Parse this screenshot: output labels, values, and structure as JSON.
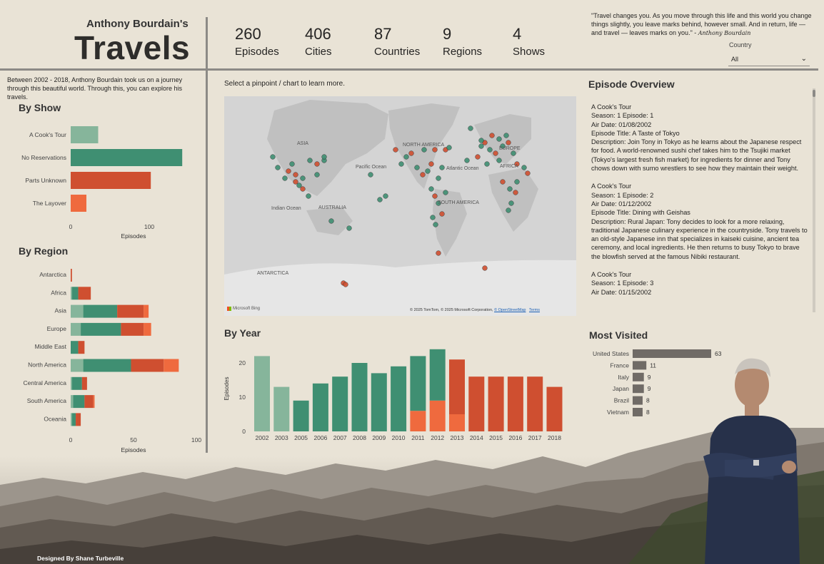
{
  "header": {
    "pre_title": "Anthony Bourdain's",
    "title": "Travels",
    "kpis": [
      {
        "value": "260",
        "label": "Episodes"
      },
      {
        "value": "406",
        "label": "Cities"
      },
      {
        "value": "87",
        "label": "Countries"
      },
      {
        "value": "9",
        "label": "Regions"
      },
      {
        "value": "4",
        "label": "Shows"
      }
    ],
    "quote": "\"Travel changes you. As you move through this life and this world you change things slightly, you leave marks behind, however small. And in return, life — and travel — leaves marks on you.\" -",
    "signature": "Anthony Bourdain",
    "country_filter": {
      "label": "Country",
      "value": "All"
    }
  },
  "intro": "Between 2002 - 2018, Anthony Bourdain took us on a journey through this beautiful world. Through this, you can explore his travels.",
  "map": {
    "instruction": "Select a pinpoint / chart to learn more.",
    "labels": [
      "ASIA",
      "NORTH AMERICA",
      "EUROPE",
      "Pacific Ocean",
      "Atlantic Ocean",
      "AFRICA",
      "Indian Ocean",
      "AUSTRALIA",
      "SOUTH AMERICA",
      "ANTARCTICA"
    ],
    "bing_label": "Microsoft Bing",
    "attribution": "© 2025 TomTom, © 2025 Microsoft Corporation,",
    "osm_link": "© OpenStreetMap",
    "terms_link": "Terms"
  },
  "colors": {
    "cooks_tour": "#86b59b",
    "no_reservations": "#3f8f72",
    "parts_unknown": "#cf4f30",
    "the_layover": "#ef6a3e",
    "gray_bar": "#706b66",
    "background": "#e9e3d6"
  },
  "by_show": {
    "title": "By Show",
    "xlabel": "Episodes",
    "ticks": [
      "0",
      "100"
    ]
  },
  "by_region": {
    "title": "By Region",
    "xlabel": "Episodes",
    "ticks": [
      "0",
      "50",
      "100"
    ]
  },
  "by_year": {
    "title": "By Year",
    "ylabel": "Episodes",
    "ticks": [
      "0",
      "10",
      "20"
    ]
  },
  "episode_overview": {
    "title": "Episode Overview",
    "episodes": [
      {
        "show": "A Cook's Tour",
        "season_episode": "Season: 1 Episode: 1",
        "air_date": "Air Date: 01/08/2002",
        "episode_title": "Episode Title: A Taste of Tokyo",
        "description": "Description: Join Tony in Tokyo as he learns about the Japanese respect for food. A world-renowned sushi chef takes him to the Tsujiki market (Tokyo's largest fresh fish market) for ingredients for dinner and Tony chows down with sumo wrestlers to see how they maintain their weight."
      },
      {
        "show": "A Cook's Tour",
        "season_episode": "Season: 1 Episode: 2",
        "air_date": "Air Date: 01/12/2002",
        "episode_title": "Episode Title: Dining with Geishas",
        "description": "Description: Rural Japan: Tony decides to look for a more relaxing, traditional Japanese culinary experience in the countryside. Tony travels to an old-style Japanese inn that specializes in kaiseki cuisine, ancient tea ceremony, and local ingredients. He then returns to busy Tokyo to brave the blowfish served at the famous Nibiki restaurant."
      },
      {
        "show": "A Cook's Tour",
        "season_episode": "Season: 1 Episode: 3",
        "air_date": "Air Date: 01/15/2002",
        "episode_title": "",
        "description": ""
      }
    ]
  },
  "most_visited": {
    "title": "Most Visited"
  },
  "credit": "Designed By Shane Turbeville",
  "chart_data": [
    {
      "type": "bar",
      "orientation": "horizontal",
      "title": "By Show",
      "xlabel": "Episodes",
      "categories": [
        "A Cook's Tour",
        "No Reservations",
        "Parts Unknown",
        "The Layover"
      ],
      "values": [
        35,
        142,
        102,
        20
      ],
      "xlim": [
        0,
        150
      ]
    },
    {
      "type": "bar",
      "orientation": "horizontal",
      "stacked": true,
      "title": "By Region",
      "xlabel": "Episodes",
      "xlim": [
        0,
        100
      ],
      "categories": [
        "Antarctica",
        "Africa",
        "Asia",
        "Europe",
        "Middle East",
        "North America",
        "Central America",
        "South America",
        "Oceania"
      ],
      "series": [
        {
          "name": "A Cook's Tour",
          "values": [
            0,
            1,
            10,
            8,
            0,
            10,
            1,
            2,
            1
          ]
        },
        {
          "name": "No Reservations",
          "values": [
            0,
            5,
            27,
            32,
            6,
            38,
            8,
            9,
            3
          ]
        },
        {
          "name": "Parts Unknown",
          "values": [
            1,
            10,
            21,
            18,
            5,
            26,
            4,
            7,
            4
          ]
        },
        {
          "name": "The Layover",
          "values": [
            0,
            0,
            4,
            6,
            0,
            12,
            0,
            1,
            0
          ]
        }
      ]
    },
    {
      "type": "bar",
      "stacked": true,
      "title": "By Year",
      "ylabel": "Episodes",
      "ylim": [
        0,
        25
      ],
      "categories": [
        "2002",
        "2003",
        "2005",
        "2006",
        "2007",
        "2008",
        "2009",
        "2010",
        "2011",
        "2012",
        "2013",
        "2014",
        "2015",
        "2016",
        "2017",
        "2018"
      ],
      "series": [
        {
          "name": "A Cook's Tour",
          "values": [
            22,
            13,
            0,
            0,
            0,
            0,
            0,
            0,
            0,
            0,
            0,
            0,
            0,
            0,
            0,
            0
          ]
        },
        {
          "name": "No Reservations",
          "values": [
            0,
            0,
            9,
            14,
            16,
            20,
            17,
            19,
            16,
            15,
            0,
            0,
            0,
            0,
            0,
            0
          ]
        },
        {
          "name": "Parts Unknown",
          "values": [
            0,
            0,
            0,
            0,
            0,
            0,
            0,
            0,
            0,
            0,
            16,
            16,
            16,
            16,
            16,
            13
          ]
        },
        {
          "name": "The Layover",
          "values": [
            0,
            0,
            0,
            0,
            0,
            0,
            0,
            0,
            6,
            9,
            5,
            0,
            0,
            0,
            0,
            0
          ]
        }
      ]
    },
    {
      "type": "bar",
      "orientation": "horizontal",
      "title": "Most Visited",
      "categories": [
        "United States",
        "France",
        "Italy",
        "Japan",
        "Brazil",
        "Vietnam"
      ],
      "values": [
        63,
        11,
        9,
        9,
        8,
        8
      ]
    }
  ]
}
